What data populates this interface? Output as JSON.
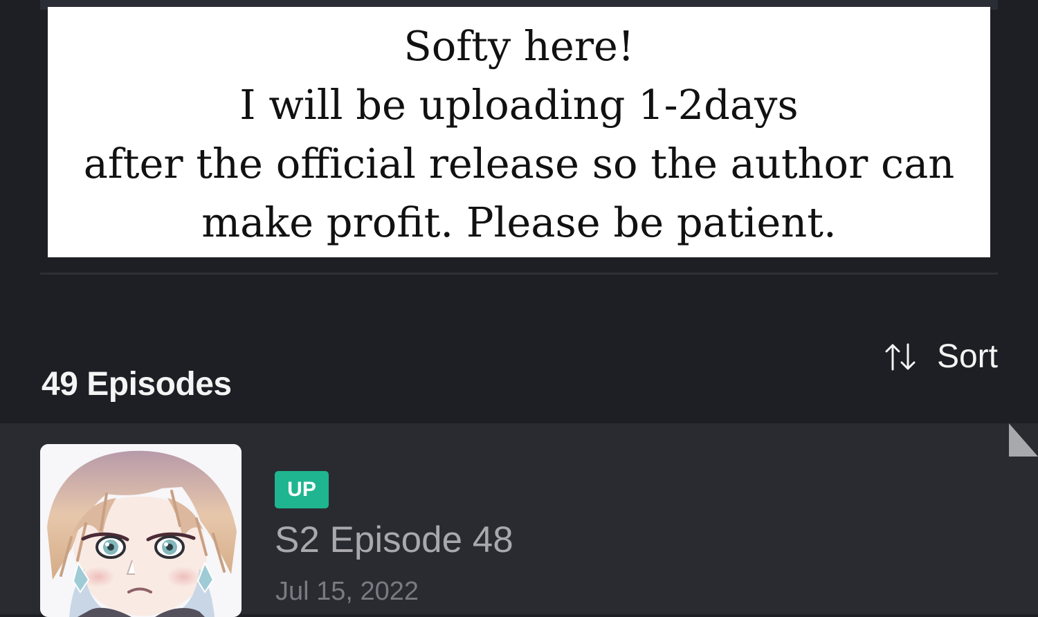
{
  "notice": {
    "lines": [
      "Softy here!",
      "I will be uploading 1-2days",
      "after the official release so the author can",
      "make profit. Please be patient."
    ]
  },
  "episodes": {
    "count_label": "49 Episodes",
    "sort": {
      "icon": "sort-arrows-icon",
      "label": "Sort"
    }
  },
  "episode_list": [
    {
      "badge": "UP",
      "title": "S2 Episode 48",
      "date": "Jul 15, 2022",
      "thumbnail": "episode-thumbnail"
    }
  ],
  "colors": {
    "background": "#1e1f24",
    "row_background": "#2a2b31",
    "badge_green": "#1fb590",
    "text_primary": "#f4f4f4",
    "text_secondary": "#a8a8ad",
    "text_muted": "#7a7b82"
  }
}
